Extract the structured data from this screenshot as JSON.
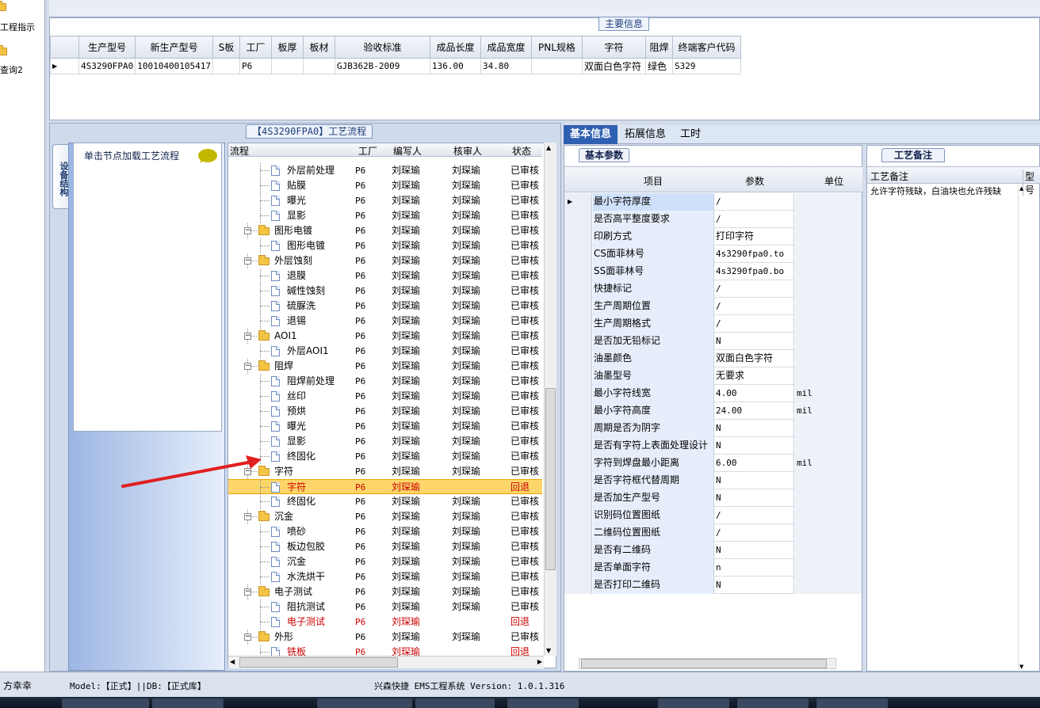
{
  "left_nav": {
    "items": [
      {
        "label": "工程指示",
        "icon": "folder-icon"
      },
      {
        "label": "查询2",
        "icon": "folder-icon"
      }
    ]
  },
  "main_info": {
    "panel_title": "主要信息",
    "columns": [
      "生产型号",
      "新生产型号",
      "S板",
      "工厂",
      "板厚",
      "板材",
      "验收标准",
      "成品长度",
      "成品宽度",
      "PNL规格",
      "字符",
      "阻焊",
      "终端客户代码"
    ],
    "rows": [
      [
        "4S3290FPA0",
        "10010400105417",
        "",
        "P6",
        "",
        "",
        "GJB362B-2009",
        "136.00",
        "34.80",
        "",
        "双面白色字符",
        "绿色",
        "S329"
      ]
    ]
  },
  "process": {
    "panel_title": "【4S3290FPA0】工艺流程",
    "vertical_tab": "设备结构",
    "load_hint": "单击节点加载工艺流程",
    "tree_headers": [
      "流程",
      "工厂",
      "编写人",
      "核审人",
      "状态"
    ],
    "rows": [
      {
        "level": 1,
        "type": "doc",
        "name": "外层前处理",
        "factory": "P6",
        "writer": "刘琛瑜",
        "reviewer": "刘琛瑜",
        "status": "已审核"
      },
      {
        "level": 1,
        "type": "doc",
        "name": "贴膜",
        "factory": "P6",
        "writer": "刘琛瑜",
        "reviewer": "刘琛瑜",
        "status": "已审核"
      },
      {
        "level": 1,
        "type": "doc",
        "name": "曝光",
        "factory": "P6",
        "writer": "刘琛瑜",
        "reviewer": "刘琛瑜",
        "status": "已审核"
      },
      {
        "level": 1,
        "type": "doc",
        "name": "显影",
        "factory": "P6",
        "writer": "刘琛瑜",
        "reviewer": "刘琛瑜",
        "status": "已审核"
      },
      {
        "level": 0,
        "type": "folder",
        "name": "图形电镀",
        "factory": "P6",
        "writer": "刘琛瑜",
        "reviewer": "刘琛瑜",
        "status": "已审核"
      },
      {
        "level": 1,
        "type": "doc",
        "name": "图形电镀",
        "factory": "P6",
        "writer": "刘琛瑜",
        "reviewer": "刘琛瑜",
        "status": "已审核"
      },
      {
        "level": 0,
        "type": "folder",
        "name": "外层蚀刻",
        "factory": "P6",
        "writer": "刘琛瑜",
        "reviewer": "刘琛瑜",
        "status": "已审核"
      },
      {
        "level": 1,
        "type": "doc",
        "name": "退膜",
        "factory": "P6",
        "writer": "刘琛瑜",
        "reviewer": "刘琛瑜",
        "status": "已审核"
      },
      {
        "level": 1,
        "type": "doc",
        "name": "碱性蚀刻",
        "factory": "P6",
        "writer": "刘琛瑜",
        "reviewer": "刘琛瑜",
        "status": "已审核"
      },
      {
        "level": 1,
        "type": "doc",
        "name": "硫脲洗",
        "factory": "P6",
        "writer": "刘琛瑜",
        "reviewer": "刘琛瑜",
        "status": "已审核"
      },
      {
        "level": 1,
        "type": "doc",
        "name": "退锡",
        "factory": "P6",
        "writer": "刘琛瑜",
        "reviewer": "刘琛瑜",
        "status": "已审核"
      },
      {
        "level": 0,
        "type": "folder",
        "name": "AOI1",
        "factory": "P6",
        "writer": "刘琛瑜",
        "reviewer": "刘琛瑜",
        "status": "已审核"
      },
      {
        "level": 1,
        "type": "doc",
        "name": "外层AOI1",
        "factory": "P6",
        "writer": "刘琛瑜",
        "reviewer": "刘琛瑜",
        "status": "已审核"
      },
      {
        "level": 0,
        "type": "folder",
        "name": "阻焊",
        "factory": "P6",
        "writer": "刘琛瑜",
        "reviewer": "刘琛瑜",
        "status": "已审核"
      },
      {
        "level": 1,
        "type": "doc",
        "name": "阻焊前处理",
        "factory": "P6",
        "writer": "刘琛瑜",
        "reviewer": "刘琛瑜",
        "status": "已审核"
      },
      {
        "level": 1,
        "type": "doc",
        "name": "丝印",
        "factory": "P6",
        "writer": "刘琛瑜",
        "reviewer": "刘琛瑜",
        "status": "已审核"
      },
      {
        "level": 1,
        "type": "doc",
        "name": "预烘",
        "factory": "P6",
        "writer": "刘琛瑜",
        "reviewer": "刘琛瑜",
        "status": "已审核"
      },
      {
        "level": 1,
        "type": "doc",
        "name": "曝光",
        "factory": "P6",
        "writer": "刘琛瑜",
        "reviewer": "刘琛瑜",
        "status": "已审核"
      },
      {
        "level": 1,
        "type": "doc",
        "name": "显影",
        "factory": "P6",
        "writer": "刘琛瑜",
        "reviewer": "刘琛瑜",
        "status": "已审核"
      },
      {
        "level": 1,
        "type": "doc",
        "name": "终固化",
        "factory": "P6",
        "writer": "刘琛瑜",
        "reviewer": "刘琛瑜",
        "status": "已审核"
      },
      {
        "level": 0,
        "type": "folder",
        "name": "字符",
        "factory": "P6",
        "writer": "刘琛瑜",
        "reviewer": "刘琛瑜",
        "status": "已审核"
      },
      {
        "level": 1,
        "type": "doc",
        "name": "字符",
        "factory": "P6",
        "writer": "刘琛瑜",
        "reviewer": "",
        "status": "回退",
        "selected": true
      },
      {
        "level": 1,
        "type": "doc",
        "name": "终固化",
        "factory": "P6",
        "writer": "刘琛瑜",
        "reviewer": "刘琛瑜",
        "status": "已审核"
      },
      {
        "level": 0,
        "type": "folder",
        "name": "沉金",
        "factory": "P6",
        "writer": "刘琛瑜",
        "reviewer": "刘琛瑜",
        "status": "已审核"
      },
      {
        "level": 1,
        "type": "doc",
        "name": "喷砂",
        "factory": "P6",
        "writer": "刘琛瑜",
        "reviewer": "刘琛瑜",
        "status": "已审核"
      },
      {
        "level": 1,
        "type": "doc",
        "name": "板边包胶",
        "factory": "P6",
        "writer": "刘琛瑜",
        "reviewer": "刘琛瑜",
        "status": "已审核"
      },
      {
        "level": 1,
        "type": "doc",
        "name": "沉金",
        "factory": "P6",
        "writer": "刘琛瑜",
        "reviewer": "刘琛瑜",
        "status": "已审核"
      },
      {
        "level": 1,
        "type": "doc",
        "name": "水洗烘干",
        "factory": "P6",
        "writer": "刘琛瑜",
        "reviewer": "刘琛瑜",
        "status": "已审核"
      },
      {
        "level": 0,
        "type": "folder",
        "name": "电子测试",
        "factory": "P6",
        "writer": "刘琛瑜",
        "reviewer": "刘琛瑜",
        "status": "已审核"
      },
      {
        "level": 1,
        "type": "doc",
        "name": "阻抗测试",
        "factory": "P6",
        "writer": "刘琛瑜",
        "reviewer": "刘琛瑜",
        "status": "已审核"
      },
      {
        "level": 1,
        "type": "doc",
        "name": "电子测试",
        "factory": "P6",
        "writer": "刘琛瑜",
        "reviewer": "",
        "status": "回退",
        "red": true
      },
      {
        "level": 0,
        "type": "folder",
        "name": "外形",
        "factory": "P6",
        "writer": "刘琛瑜",
        "reviewer": "刘琛瑜",
        "status": "已审核"
      },
      {
        "level": 1,
        "type": "doc",
        "name": "铣板",
        "factory": "P6",
        "writer": "刘琛瑜",
        "reviewer": "",
        "status": "回退",
        "red": true
      }
    ]
  },
  "basic_info": {
    "tabs": [
      "基本信息",
      "拓展信息",
      "工时"
    ],
    "sub_tab": "基本参数",
    "columns": [
      "项目",
      "参数",
      "单位"
    ],
    "rows": [
      {
        "item": "最小字符厚度",
        "value": "/",
        "unit": ""
      },
      {
        "item": "是否高平整度要求",
        "value": "/",
        "unit": ""
      },
      {
        "item": "印刷方式",
        "value": "打印字符",
        "unit": ""
      },
      {
        "item": "CS面菲林号",
        "value": "4s3290fpa0.to",
        "unit": ""
      },
      {
        "item": "SS面菲林号",
        "value": "4s3290fpa0.bo",
        "unit": ""
      },
      {
        "item": "快捷标记",
        "value": "/",
        "unit": ""
      },
      {
        "item": "生产周期位置",
        "value": "/",
        "unit": ""
      },
      {
        "item": "生产周期格式",
        "value": "/",
        "unit": ""
      },
      {
        "item": "是否加无铅标记",
        "value": "N",
        "unit": ""
      },
      {
        "item": "油墨颜色",
        "value": "双面白色字符",
        "unit": ""
      },
      {
        "item": "油墨型号",
        "value": "无要求",
        "unit": ""
      },
      {
        "item": "最小字符线宽",
        "value": "4.00",
        "unit": "mil"
      },
      {
        "item": "最小字符高度",
        "value": "24.00",
        "unit": "mil"
      },
      {
        "item": "周期是否为阴字",
        "value": "N",
        "unit": ""
      },
      {
        "item": "是否有字符上表面处理设计",
        "value": "N",
        "unit": ""
      },
      {
        "item": "字符到焊盘最小距离",
        "value": "6.00",
        "unit": "mil"
      },
      {
        "item": "是否字符框代替周期",
        "value": "N",
        "unit": ""
      },
      {
        "item": "是否加生产型号",
        "value": "N",
        "unit": ""
      },
      {
        "item": "识别码位置图纸",
        "value": "/",
        "unit": ""
      },
      {
        "item": "二维码位置图纸",
        "value": "/",
        "unit": ""
      },
      {
        "item": "是否有二维码",
        "value": "N",
        "unit": ""
      },
      {
        "item": "是否单面字符",
        "value": "n",
        "unit": ""
      },
      {
        "item": "是否打印二维码",
        "value": "N",
        "unit": ""
      }
    ]
  },
  "remarks": {
    "tab": "工艺备注",
    "column": "工艺备注",
    "column2": "型号",
    "text": "允许字符残缺，白油块也允许残缺"
  },
  "status_bar": {
    "user": "方幸幸",
    "model": "Model:【正式】||DB:【正式库】",
    "app": "兴森快捷 EMS工程系统 Version: 1.0.1.316"
  },
  "colors": {
    "accent": "#2f5fb0",
    "selected_row": "#fcd66a",
    "revert_text": "#cc0000",
    "arrow": "#e02020"
  }
}
